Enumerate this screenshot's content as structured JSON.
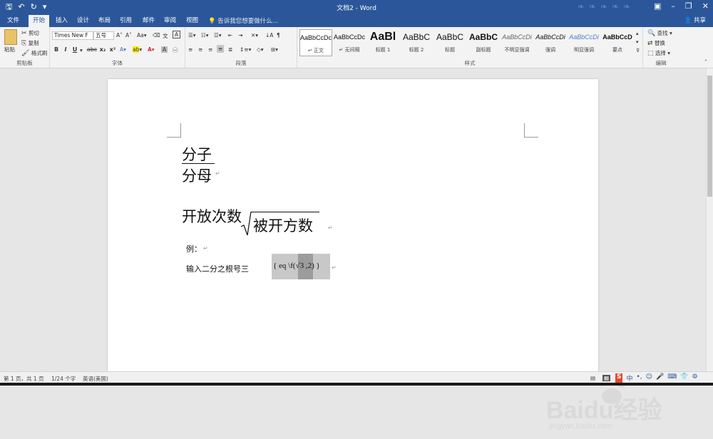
{
  "titlebar": {
    "title": "文档2 - Word",
    "quick_access": [
      "save-icon",
      "undo-icon",
      "redo-icon",
      "customize-icon"
    ]
  },
  "tabs": [
    {
      "label": "文件"
    },
    {
      "label": "开始",
      "active": true
    },
    {
      "label": "插入"
    },
    {
      "label": "设计"
    },
    {
      "label": "布局"
    },
    {
      "label": "引用"
    },
    {
      "label": "邮件"
    },
    {
      "label": "审阅"
    },
    {
      "label": "视图"
    }
  ],
  "tell_me": "告诉我您想要做什么...",
  "share": "共享",
  "clipboard": {
    "paste": "粘贴",
    "cut": "剪切",
    "copy": "复制",
    "format_painter": "格式刷",
    "group_label": "剪贴板"
  },
  "font": {
    "name": "Times New F",
    "size": "五号",
    "group_label": "字体",
    "bold": "B",
    "italic": "I",
    "underline": "U",
    "strike": "abc",
    "subscript": "x₂",
    "superscript": "x²"
  },
  "paragraph": {
    "group_label": "段落"
  },
  "styles": {
    "group_label": "样式",
    "items": [
      {
        "sample": "AaBbCcDc",
        "name": "正文"
      },
      {
        "sample": "AaBbCcDc",
        "name": "无间隔"
      },
      {
        "sample": "AaBl",
        "name": "标题 1"
      },
      {
        "sample": "AaBbC",
        "name": "标题 2"
      },
      {
        "sample": "AaBbC",
        "name": "标题"
      },
      {
        "sample": "AaBbC",
        "name": "副标题"
      },
      {
        "sample": "AaBbCcDi",
        "name": "不明显强调"
      },
      {
        "sample": "AaBbCcDi",
        "name": "强调"
      },
      {
        "sample": "AaBbCcDi",
        "name": "明显强调"
      },
      {
        "sample": "AaBbCcD",
        "name": "要点"
      }
    ]
  },
  "editing": {
    "find": "查找",
    "replace": "替换",
    "select": "选择",
    "group_label": "编辑"
  },
  "document": {
    "numerator": "分子",
    "denominator": "分母",
    "index": "开放次数",
    "radicand": "被开方数",
    "example": "例：",
    "instruction": "输入二分之根号三",
    "field_code": "{ eq \\f(√3 ,2) }"
  },
  "status": {
    "page": "第 1 页，共 1 页",
    "words": "1/24 个字",
    "language": "英语(美国)"
  },
  "watermark": {
    "brand": "Baidu经验",
    "url": "jingyan.baidu.com"
  }
}
